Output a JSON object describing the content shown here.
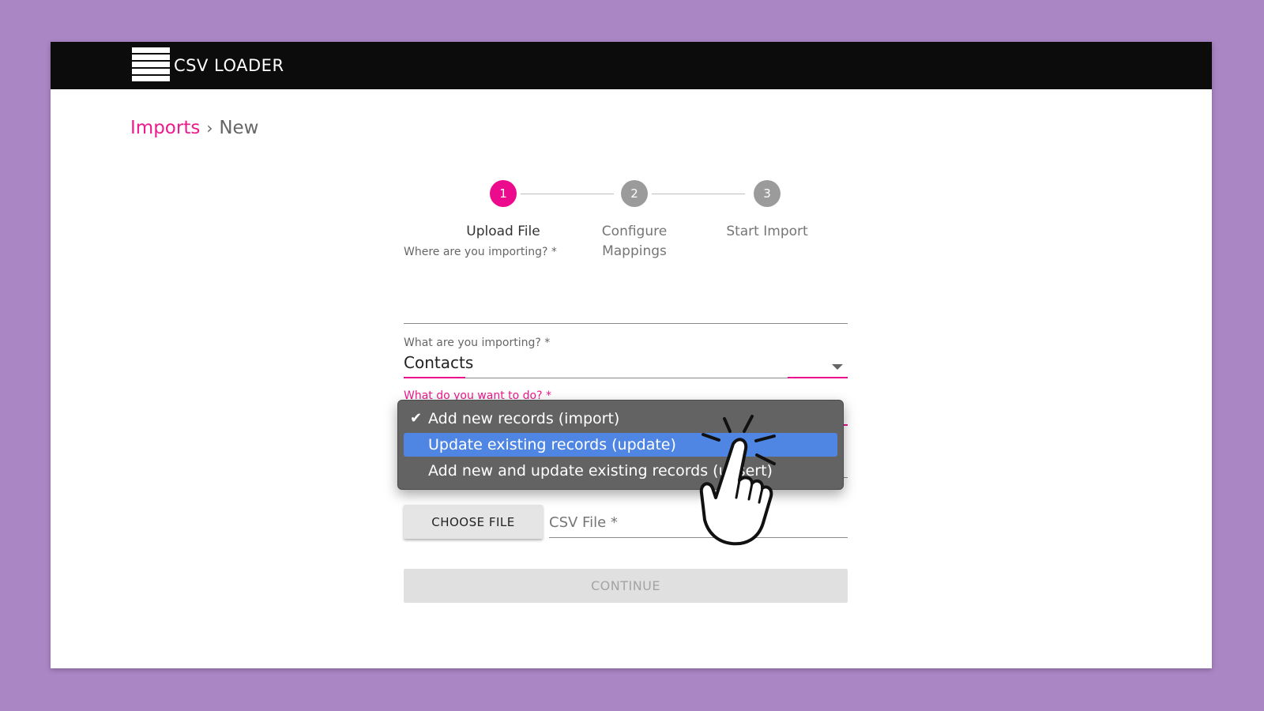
{
  "app": {
    "title": "CSV LOADER",
    "logo_icon": "stacked-bars-logo-icon"
  },
  "breadcrumb": {
    "root": "Imports",
    "separator": "›",
    "current": "New"
  },
  "stepper": {
    "steps": [
      {
        "number": "1",
        "label": "Upload File",
        "state": "active"
      },
      {
        "number": "2",
        "label_line1": "Configure",
        "label_line2": "Mappings",
        "state": "inactive"
      },
      {
        "number": "3",
        "label": "Start Import",
        "state": "inactive"
      }
    ]
  },
  "form": {
    "where": {
      "label": "Where are you importing? *",
      "value": ""
    },
    "what": {
      "label": "What are you importing? *",
      "value": "Contacts"
    },
    "action": {
      "label": "What do you want to do? *",
      "options": [
        {
          "label": "Add new records (import)",
          "checked": true
        },
        {
          "label": "Update existing records (update)",
          "highlighted": true
        },
        {
          "label": "Add new and update existing records (upsert)"
        }
      ]
    },
    "file": {
      "button_label": "CHOOSE FILE",
      "placeholder": "CSV File *"
    },
    "continue_label": "CONTINUE"
  },
  "colors": {
    "accent": "#ec0b8c",
    "topbar": "#0c0c0c",
    "background": "#ab86c5",
    "highlight": "#4f86e3"
  },
  "overlay": {
    "cursor_icon": "pointing-hand-cursor-icon"
  }
}
